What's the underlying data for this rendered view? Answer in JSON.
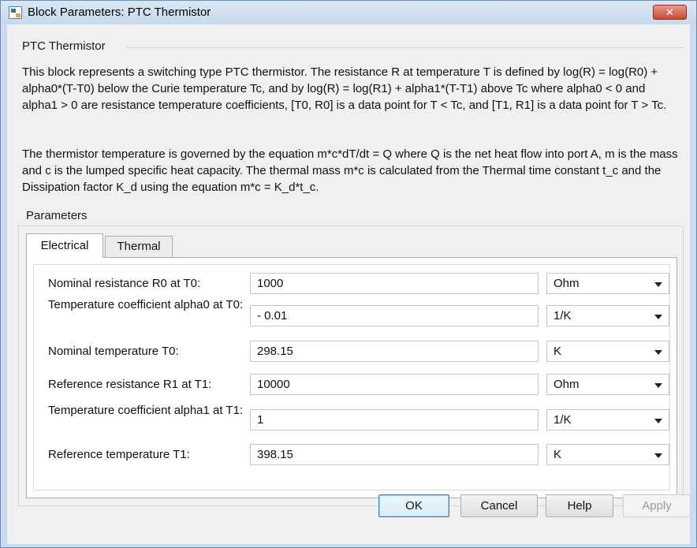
{
  "window": {
    "title": "Block Parameters: PTC Thermistor",
    "close_label": "✕"
  },
  "block": {
    "name": "PTC Thermistor",
    "description_1": "This block represents a switching type PTC thermistor. The resistance R at temperature T is defined by log(R) = log(R0) + alpha0*(T-T0) below the Curie temperature Tc, and by log(R) = log(R1) + alpha1*(T-T1) above Tc where alpha0 < 0 and alpha1 > 0 are resistance temperature coefficients, [T0, R0] is a data point for T < Tc, and [T1, R1] is a data point for T > Tc.",
    "description_2": "The thermistor temperature is governed by the equation m*c*dT/dt = Q where Q is the net heat flow into port A, m is the mass and c is the lumped specific heat capacity. The thermal mass m*c is calculated from the Thermal time constant t_c and the Dissipation factor K_d using the equation m*c = K_d*t_c."
  },
  "parameters": {
    "title": "Parameters",
    "tabs": [
      {
        "label": "Electrical",
        "active": true
      },
      {
        "label": "Thermal",
        "active": false
      }
    ],
    "rows": [
      {
        "label": "Nominal resistance R0 at T0:",
        "value": "1000",
        "unit": "Ohm"
      },
      {
        "label": "Temperature coefficient alpha0 at T0:",
        "value": "- 0.01",
        "unit": "1/K"
      },
      {
        "label": "Nominal temperature T0:",
        "value": "298.15",
        "unit": "K"
      },
      {
        "label": "Reference resistance R1 at T1:",
        "value": "10000",
        "unit": "Ohm"
      },
      {
        "label": "Temperature coefficient alpha1 at T1:",
        "value": "1",
        "unit": "1/K"
      },
      {
        "label": "Reference temperature T1:",
        "value": "398.15",
        "unit": "K"
      }
    ]
  },
  "buttons": {
    "ok": "OK",
    "cancel": "Cancel",
    "help": "Help",
    "apply": "Apply"
  },
  "icons": {
    "app": "simulink-block-icon",
    "close": "close-icon",
    "dropdown": "chevron-down-icon"
  }
}
